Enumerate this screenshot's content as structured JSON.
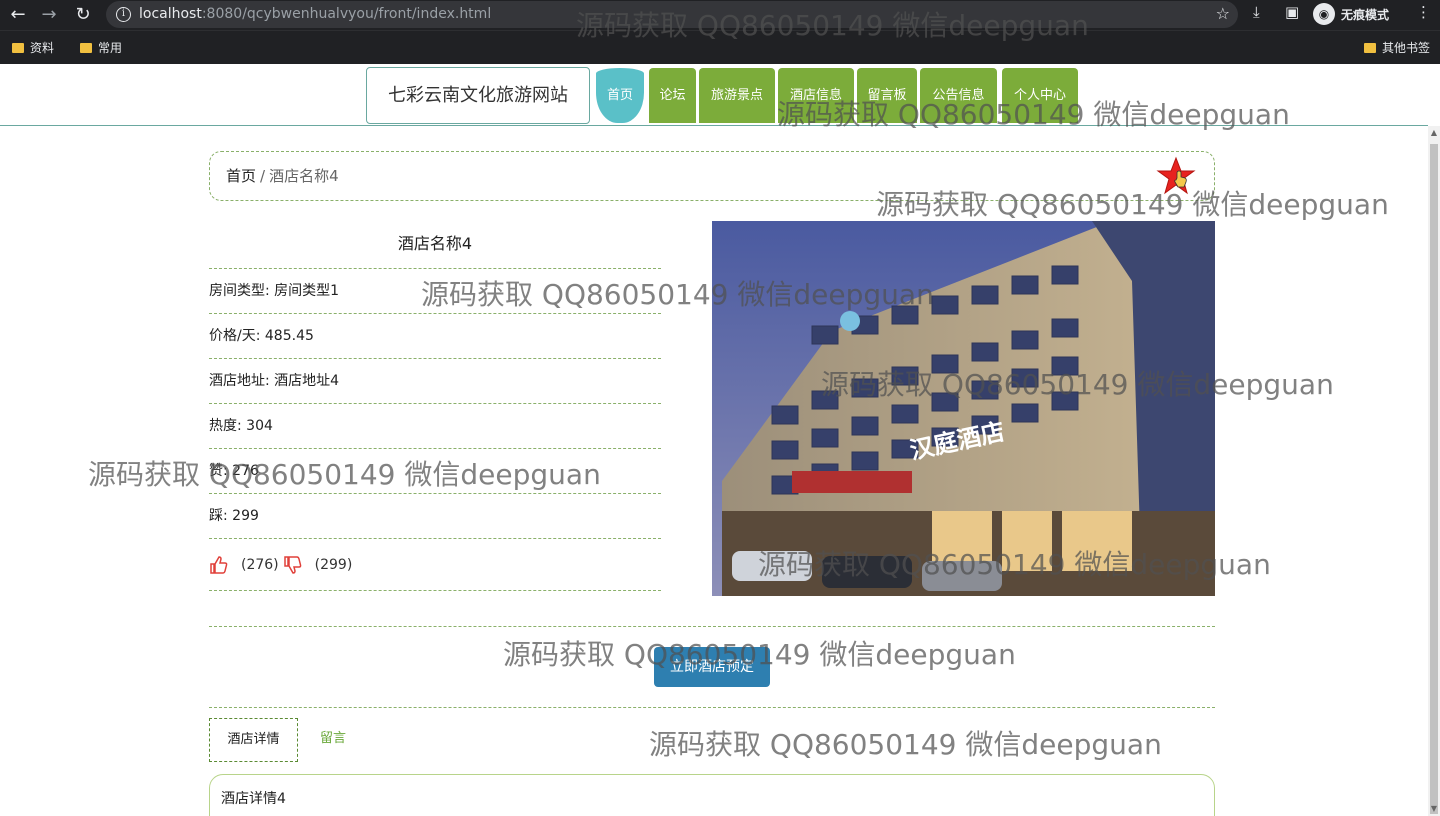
{
  "browser": {
    "url_host": "localhost",
    "url_rest": ":8080/qcybwenhualvyou/front/index.html",
    "incognito_label": "无痕模式",
    "bookmarks": [
      "资料",
      "常用"
    ],
    "other_bookmarks": "其他书签"
  },
  "site": {
    "title": "七彩云南文化旅游网站",
    "nav": [
      "首页",
      "论坛",
      "旅游景点",
      "酒店信息",
      "留言板",
      "公告信息",
      "个人中心"
    ]
  },
  "breadcrumb": {
    "home": "首页",
    "separator": "/",
    "current": "酒店名称4"
  },
  "hotel": {
    "name": "酒店名称4",
    "fields": [
      {
        "label": "房间类型:",
        "value": "房间类型1"
      },
      {
        "label": "价格/天:",
        "value": "485.45"
      },
      {
        "label": "酒店地址:",
        "value": "酒店地址4"
      },
      {
        "label": "热度:",
        "value": "304"
      },
      {
        "label": "赞:",
        "value": "276"
      },
      {
        "label": "踩:",
        "value": "299"
      }
    ],
    "likes": "(276)",
    "dislikes": "(299)",
    "sign_text": "汉庭酒店"
  },
  "actions": {
    "book_label": "立即酒店预定"
  },
  "tabs": [
    "酒店详情",
    "留言"
  ],
  "detail_text": "酒店详情4",
  "watermark": "源码获取 QQ86050149 微信deepguan",
  "colors": {
    "nav_green": "#7cac3a",
    "nav_active": "#5ac0c8",
    "button_blue": "#2e7fb0",
    "dashed_border": "#8ab06a"
  }
}
